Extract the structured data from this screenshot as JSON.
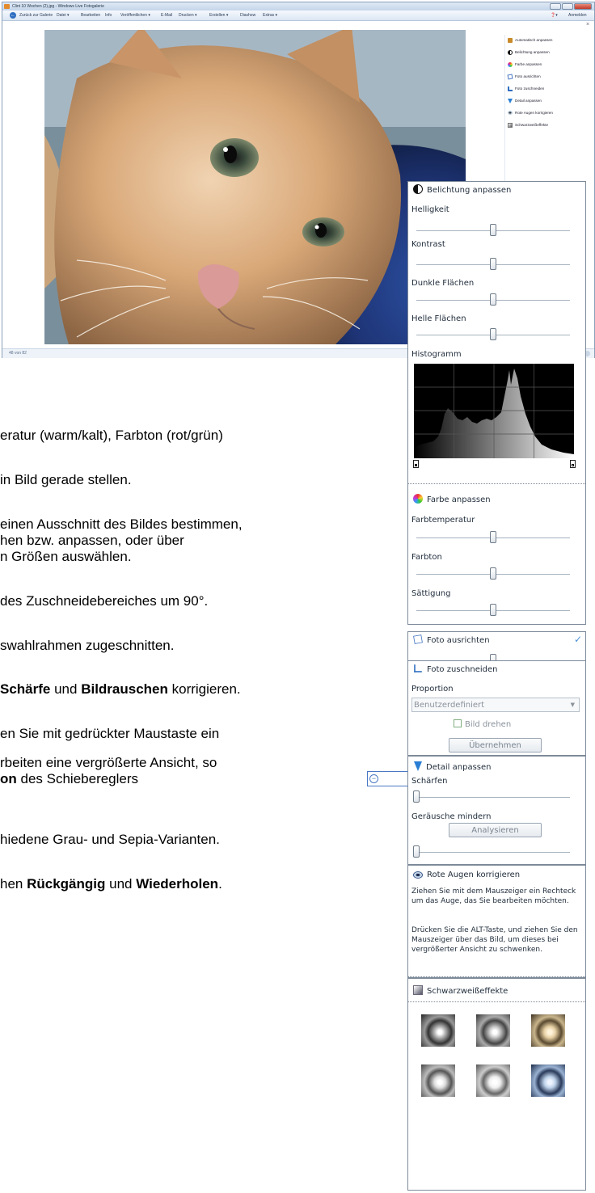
{
  "window": {
    "title": "Clint 10 Wochen (2).jpg - Windows Live Fotogalerie",
    "back_label": "Zurück zur Galerie",
    "menu": [
      "Datei ▾",
      "Bearbeiten",
      "Info",
      "Veröffentlichen ▾",
      "E-Mail",
      "Drucken ▾",
      "Erstellen ▾",
      "Diashow",
      "Extras ▾"
    ],
    "help_label": "❓▾",
    "signin_label": "Anmelden",
    "status_text": "48 von 82",
    "close_x": "×",
    "right_menu": [
      "Automatisch anpassen",
      "Belichtung anpassen",
      "Farbe anpassen",
      "Foto ausrichten",
      "Foto zuschneiden",
      "Detail anpassen",
      "Rote Augen korrigieren",
      "Schwarzweißeffekte"
    ]
  },
  "body_lines": {
    "l1": "eratur (warm/kalt), Farbton (rot/grün)",
    "l2": "in Bild gerade stellen.",
    "l3": "einen Ausschnitt des Bildes bestimmen,",
    "l4": "hen bzw. anpassen, oder über",
    "l5": "n Größen auswählen.",
    "l6": " des Zuschneidebereiches um 90°.",
    "l7": "swahlrahmen zugeschnitten.",
    "l8a": "Schärfe",
    "l8b": " und ",
    "l8c": "Bildrauschen",
    "l8d": " korrigieren.",
    "l9": "en Sie mit gedrückter Maustaste ein",
    "l10": "rbeiten eine vergrößerte Ansicht, so",
    "l11a": "on",
    "l11b": " des Schiebereglers",
    "l12": "hiedene Grau- und Sepia-Varianten.",
    "l13a": "hen ",
    "l13b": "Rückgängig",
    "l13c": " und ",
    "l13d": "Wiederholen",
    "l13e": "."
  },
  "exposure": {
    "title": "Belichtung anpassen",
    "brightness": "Helligkeit",
    "contrast": "Kontrast",
    "shadows": "Dunkle Flächen",
    "highlights": "Helle Flächen",
    "histogram": "Histogramm",
    "brightness_level": 0.5,
    "contrast_level": 0.5,
    "shadows_level": 0.5,
    "highlights_level": 0.5
  },
  "color": {
    "title": "Farbe anpassen",
    "temperature": "Farbtemperatur",
    "tint": "Farbton",
    "saturation": "Sättigung",
    "temperature_level": 0.5,
    "tint_level": 0.5,
    "saturation_level": 0.5
  },
  "straighten": {
    "title": "Foto ausrichten",
    "check": "✓",
    "level": 0.5
  },
  "crop": {
    "title": "Foto zuschneiden",
    "proportion_label": "Proportion",
    "proportion_value": "Benutzerdefiniert",
    "rotate_label": "Bild drehen",
    "apply_label": "Übernehmen"
  },
  "detail": {
    "title": "Detail anpassen",
    "sharpen": "Schärfen",
    "noise": "Geräusche mindern",
    "analyze_label": "Analysieren",
    "sharpen_level": 0,
    "noise_level": 0
  },
  "redeye": {
    "title": "Rote Augen korrigieren",
    "text1": "Ziehen Sie mit dem Mauszeiger ein Rechteck um das Auge, das Sie bearbeiten möchten.",
    "text2": "Drücken Sie die ALT-Taste, und ziehen Sie den Mauszeiger über das Bild, um dieses bei vergrößerter Ansicht zu schwenken."
  },
  "bw": {
    "title": "Schwarzweißeffekte"
  },
  "colors": {
    "accent": "#2f6fc1",
    "panel_border": "#7d8a99",
    "detail_icon": "#2a7fd4"
  }
}
